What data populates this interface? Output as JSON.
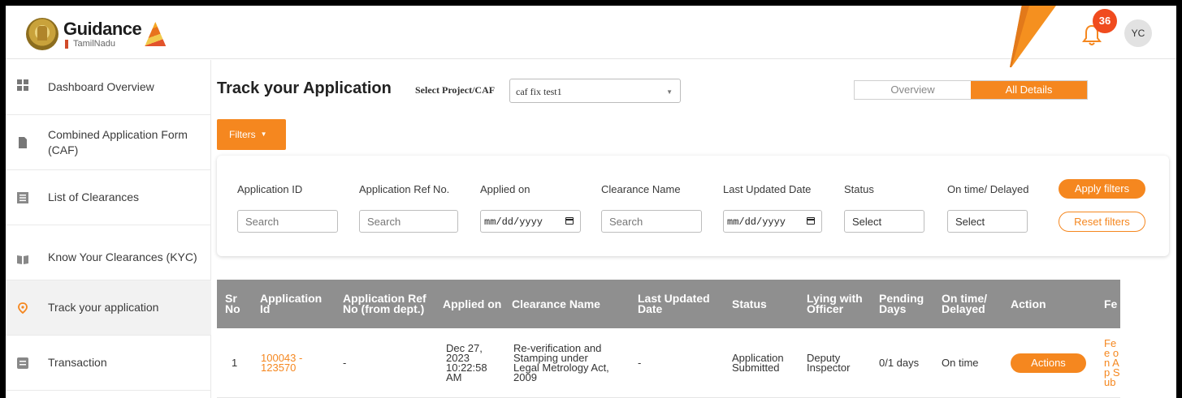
{
  "header": {
    "logo_main": "Guidance",
    "logo_sub": "TamilNadu",
    "notification_count": "36",
    "avatar_initials": "YC"
  },
  "sidebar": {
    "items": [
      {
        "label": "Dashboard Overview",
        "icon": "dashboard-icon"
      },
      {
        "label": "Combined Application Form (CAF)",
        "icon": "document-icon"
      },
      {
        "label": "List of Clearances",
        "icon": "list-icon"
      },
      {
        "label": "Know Your Clearances (KYC)",
        "icon": "book-icon"
      },
      {
        "label": "Track your application",
        "icon": "location-pin-icon",
        "active": true
      },
      {
        "label": "Transaction",
        "icon": "transaction-icon"
      }
    ]
  },
  "main": {
    "title": "Track your Application",
    "select_label": "Select Project/CAF",
    "select_value": "caf fix test1",
    "toggle": {
      "overview": "Overview",
      "all_details": "All Details",
      "selected": "All Details"
    },
    "filters_button": "Filters"
  },
  "filters": {
    "labels": [
      "Application ID",
      "Application Ref No.",
      "Applied on",
      "Clearance Name",
      "Last Updated Date",
      "Status",
      "On time/ Delayed"
    ],
    "application_id_placeholder": "Search",
    "ref_no_placeholder": "Search",
    "applied_on_value": "mm/dd/yyyy",
    "clearance_name_placeholder": "Search",
    "last_updated_value": "mm/dd/yyyy",
    "status_value": "Select",
    "ontime_value": "Select",
    "apply_button": "Apply filters",
    "reset_button": "Reset filters"
  },
  "table": {
    "columns": [
      "Sr No",
      "Application Id",
      "Application Ref No (from dept.)",
      "Applied on",
      "Clearance Name",
      "Last Updated Date",
      "Status",
      "Lying with Officer",
      "Pending Days",
      "On time/ Delayed",
      "Action",
      "Fe"
    ],
    "rows": [
      {
        "sr": "1",
        "app_id": "100043 - 123570",
        "ref_no": "-",
        "applied_on": "Dec 27, 2023 10:22:58 AM",
        "clearance": "Re-verification and Stamping under Legal Metrology Act, 2009",
        "last_updated": "-",
        "status": "Application Submitted",
        "officer": "Deputy Inspector",
        "pending": "0/1 days",
        "ontime": "On time",
        "action": "Actions",
        "fee": "Fee on Ap Sub"
      }
    ]
  },
  "colors": {
    "accent": "#f5871f",
    "table_header": "#8f8f8f",
    "badge": "#f04b1e"
  }
}
